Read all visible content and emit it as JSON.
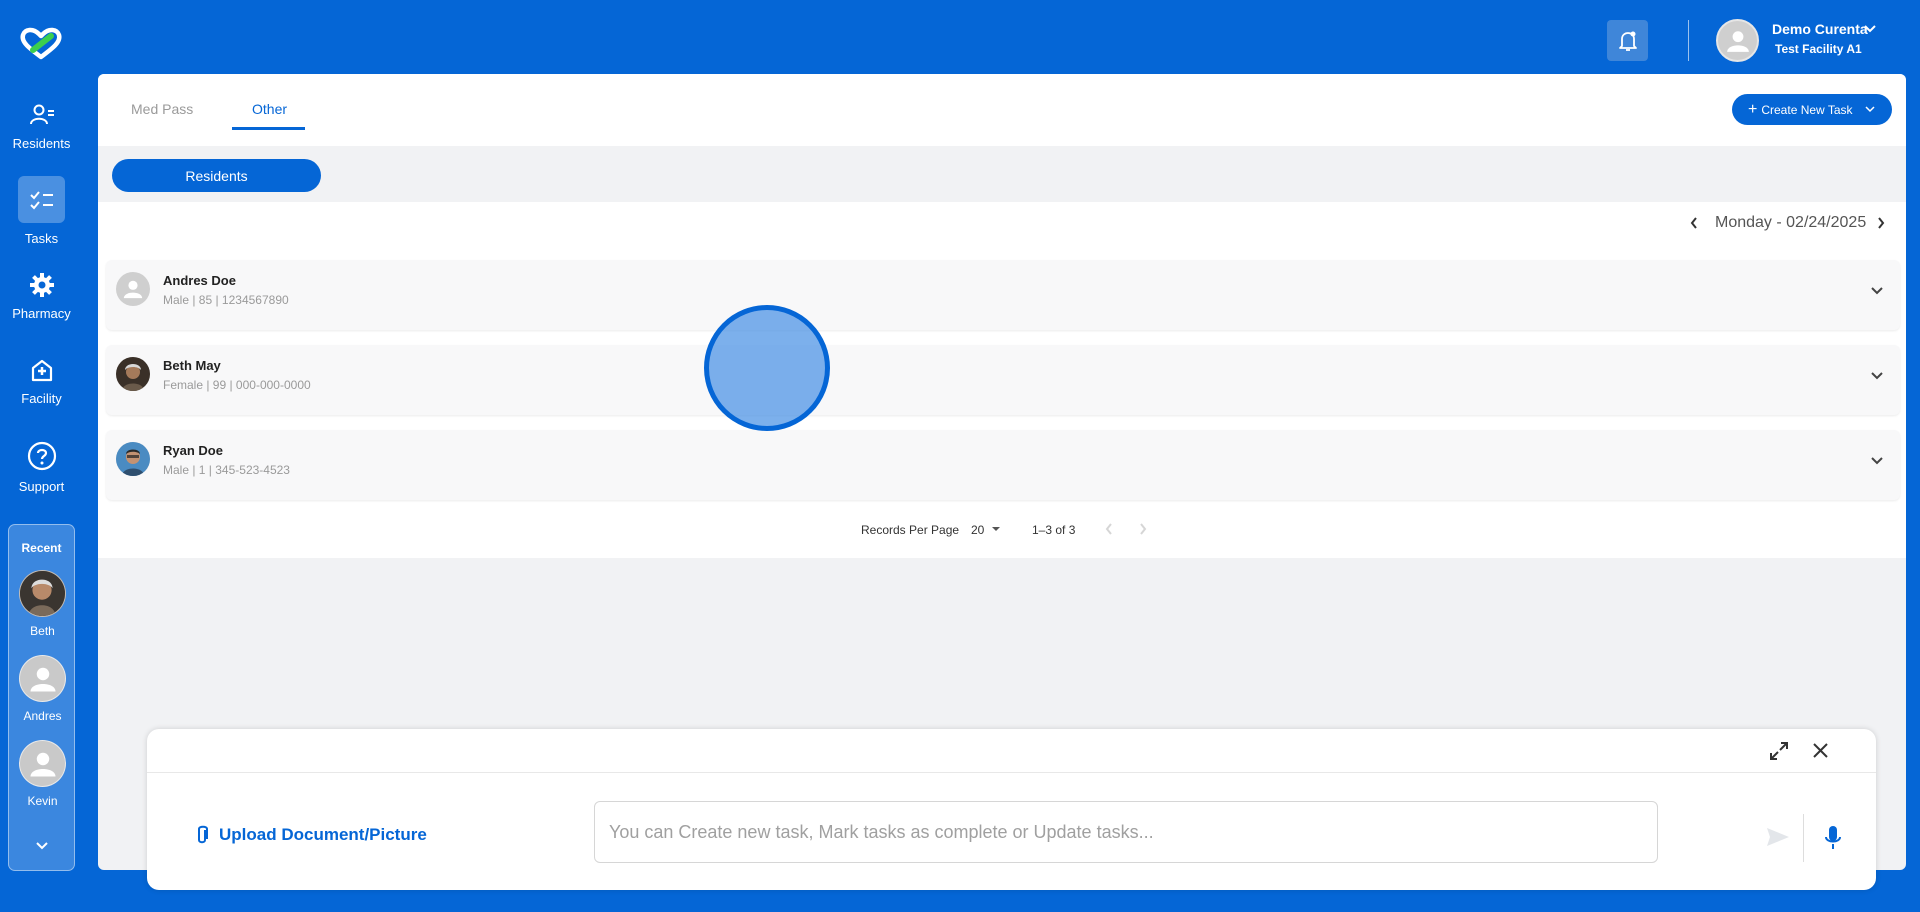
{
  "sidebar": {
    "items": [
      {
        "label": "Residents",
        "icon": "residents-icon"
      },
      {
        "label": "Tasks",
        "icon": "tasks-icon"
      },
      {
        "label": "Pharmacy",
        "icon": "gear-icon"
      },
      {
        "label": "Facility",
        "icon": "facility-icon"
      },
      {
        "label": "Support",
        "icon": "help-icon"
      }
    ],
    "recent": {
      "title": "Recent",
      "items": [
        {
          "label": "Beth"
        },
        {
          "label": "Andres"
        },
        {
          "label": "Kevin"
        }
      ]
    }
  },
  "header": {
    "user_name": "Demo Curenta",
    "facility": "Test Facility A1"
  },
  "tabs": [
    {
      "label": "Med Pass"
    },
    {
      "label": "Other"
    }
  ],
  "create_button": "Create New Task",
  "filter_pill": "Residents",
  "date_label": "Monday - 02/24/2025",
  "residents": [
    {
      "name": "Andres Doe",
      "details": "Male | 85 | 1234567890"
    },
    {
      "name": "Beth May",
      "details": "Female | 99 | 000-000-0000"
    },
    {
      "name": "Ryan Doe",
      "details": "Male | 1 | 345-523-4523"
    }
  ],
  "pager": {
    "records_label": "Records Per Page",
    "per_page": "20",
    "range": "1–3 of 3"
  },
  "assistant": {
    "upload_label": "Upload Document/Picture",
    "placeholder": "You can Create new task, Mark tasks as complete or Update tasks..."
  },
  "colors": {
    "brand": "#0566d6",
    "background": "#f1f2f4"
  }
}
